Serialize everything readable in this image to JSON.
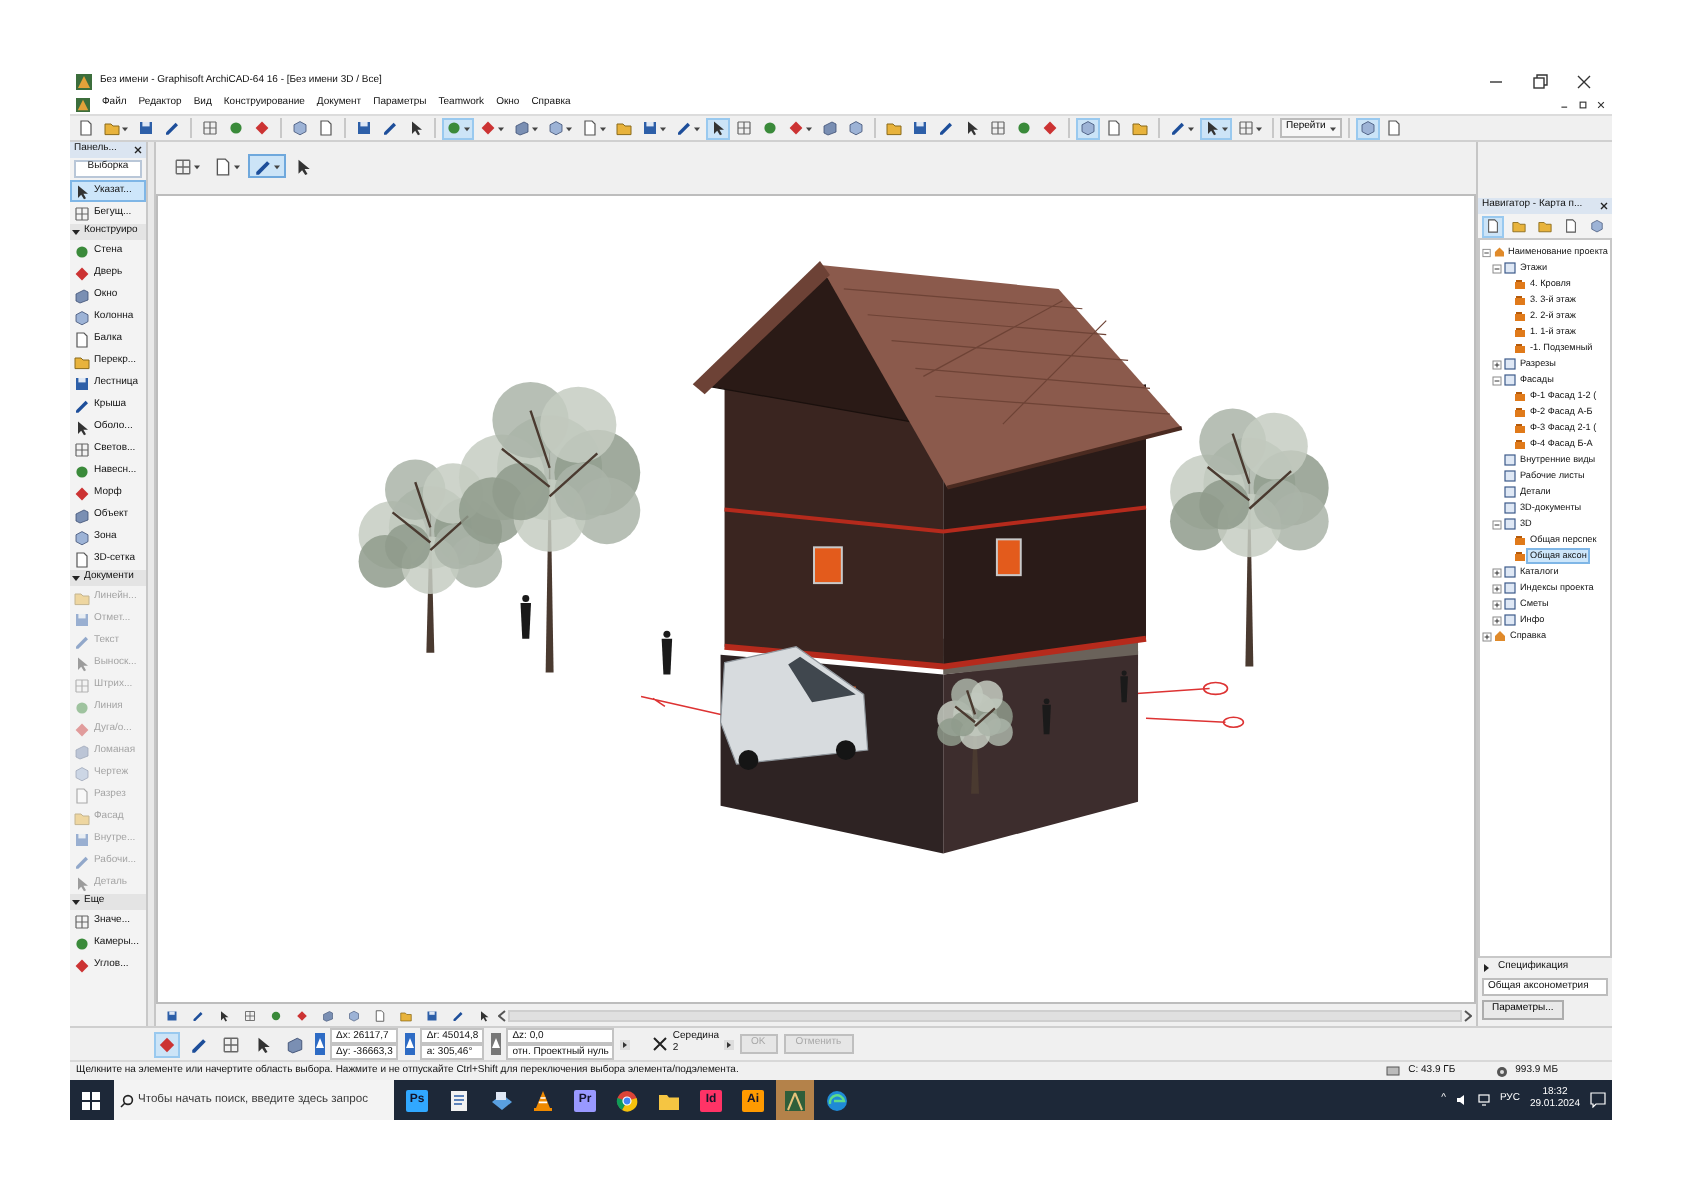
{
  "window": {
    "title": "Без имени - Graphisoft ArchiCAD-64 16 - [Без имени 3D / Все]"
  },
  "menu": [
    "Файл",
    "Редактор",
    "Вид",
    "Конструирование",
    "Документ",
    "Параметры",
    "Teamwork",
    "Окно",
    "Справка"
  ],
  "toolbar": [
    {
      "kind": "button",
      "selected": false
    },
    {
      "kind": "split",
      "selected": false
    },
    {
      "kind": "button",
      "selected": false
    },
    {
      "kind": "button",
      "selected": false
    },
    {
      "kind": "divider"
    },
    {
      "kind": "button",
      "selected": false
    },
    {
      "kind": "button",
      "selected": false
    },
    {
      "kind": "button",
      "selected": false
    },
    {
      "kind": "divider"
    },
    {
      "kind": "button",
      "selected": false
    },
    {
      "kind": "button",
      "selected": false
    },
    {
      "kind": "divider"
    },
    {
      "kind": "button",
      "selected": false
    },
    {
      "kind": "button",
      "selected": false
    },
    {
      "kind": "button",
      "selected": false
    },
    {
      "kind": "divider"
    },
    {
      "kind": "split",
      "selected": true
    },
    {
      "kind": "split",
      "selected": false
    },
    {
      "kind": "split",
      "selected": false
    },
    {
      "kind": "split",
      "selected": false
    },
    {
      "kind": "split",
      "selected": false
    },
    {
      "kind": "button",
      "selected": false
    },
    {
      "kind": "split",
      "selected": false
    },
    {
      "kind": "split",
      "selected": false
    },
    {
      "kind": "button",
      "selected": true
    },
    {
      "kind": "button",
      "selected": false
    },
    {
      "kind": "button",
      "selected": false
    },
    {
      "kind": "split",
      "selected": false
    },
    {
      "kind": "button",
      "selected": false
    },
    {
      "kind": "button",
      "selected": false
    },
    {
      "kind": "divider"
    },
    {
      "kind": "button",
      "selected": false
    },
    {
      "kind": "button",
      "selected": false
    },
    {
      "kind": "button",
      "selected": false
    },
    {
      "kind": "button",
      "selected": false
    },
    {
      "kind": "button",
      "selected": false
    },
    {
      "kind": "button",
      "selected": false
    },
    {
      "kind": "button",
      "selected": false
    },
    {
      "kind": "divider"
    },
    {
      "kind": "button",
      "selected": true
    },
    {
      "kind": "button",
      "selected": false
    },
    {
      "kind": "button",
      "selected": false
    },
    {
      "kind": "divider"
    },
    {
      "kind": "split",
      "selected": false
    },
    {
      "kind": "split",
      "selected": true
    },
    {
      "kind": "split",
      "selected": false
    },
    {
      "kind": "divider"
    },
    {
      "kind": "menu",
      "label": "Перейти"
    },
    {
      "kind": "divider"
    },
    {
      "kind": "button",
      "selected": true
    },
    {
      "kind": "button",
      "selected": false
    }
  ],
  "palette": {
    "title": "Панель...",
    "tab": "Выборка",
    "top_items": [
      {
        "label": "Указат...",
        "selected": true,
        "disabled": false
      },
      {
        "label": "Бегущ...",
        "selected": false,
        "disabled": false
      }
    ],
    "sections": [
      {
        "title": "Конструиро",
        "expanded": true,
        "items": [
          {
            "label": "Стена",
            "selected": false,
            "disabled": false
          },
          {
            "label": "Дверь",
            "selected": false,
            "disabled": false
          },
          {
            "label": "Окно",
            "selected": false,
            "disabled": false
          },
          {
            "label": "Колонна",
            "selected": false,
            "disabled": false
          },
          {
            "label": "Балка",
            "selected": false,
            "disabled": false
          },
          {
            "label": "Перекр...",
            "selected": false,
            "disabled": false
          },
          {
            "label": "Лестница",
            "selected": false,
            "disabled": false
          },
          {
            "label": "Крыша",
            "selected": false,
            "disabled": false
          },
          {
            "label": "Оболо...",
            "selected": false,
            "disabled": false
          },
          {
            "label": "Светов...",
            "selected": false,
            "disabled": false
          },
          {
            "label": "Навесн...",
            "selected": false,
            "disabled": false
          },
          {
            "label": "Морф",
            "selected": false,
            "disabled": false
          },
          {
            "label": "Объект",
            "selected": false,
            "disabled": false
          },
          {
            "label": "Зона",
            "selected": false,
            "disabled": false
          },
          {
            "label": "3D-сетка",
            "selected": false,
            "disabled": false
          }
        ]
      },
      {
        "title": "Документи",
        "expanded": true,
        "items": [
          {
            "label": "Линейн...",
            "selected": false,
            "disabled": true
          },
          {
            "label": "Отмет...",
            "selected": false,
            "disabled": true
          },
          {
            "label": "Текст",
            "selected": false,
            "disabled": true
          },
          {
            "label": "Выноск...",
            "selected": false,
            "disabled": true
          },
          {
            "label": "Штрих...",
            "selected": false,
            "disabled": true
          },
          {
            "label": "Линия",
            "selected": false,
            "disabled": true
          },
          {
            "label": "Дуга/о...",
            "selected": false,
            "disabled": true
          },
          {
            "label": "Ломаная",
            "selected": false,
            "disabled": true
          },
          {
            "label": "Чертеж",
            "selected": false,
            "disabled": true
          },
          {
            "label": "Разрез",
            "selected": false,
            "disabled": true
          },
          {
            "label": "Фасад",
            "selected": false,
            "disabled": true
          },
          {
            "label": "Внутре...",
            "selected": false,
            "disabled": true
          },
          {
            "label": "Рабочи...",
            "selected": false,
            "disabled": true
          },
          {
            "label": "Деталь",
            "selected": false,
            "disabled": true
          }
        ]
      },
      {
        "title": "Еще",
        "expanded": true,
        "items": [
          {
            "label": "Значе...",
            "selected": false,
            "disabled": false
          },
          {
            "label": "Камеры...",
            "selected": false,
            "disabled": false
          },
          {
            "label": "Углов...",
            "selected": false,
            "disabled": false
          }
        ]
      }
    ]
  },
  "view_toolbar": [
    {
      "selected": false
    },
    {
      "selected": false
    },
    {
      "selected": true
    },
    {
      "selected": false
    }
  ],
  "navigator": {
    "title": "Навигатор - Карта п...",
    "tools": [
      {
        "selected": true
      },
      {
        "selected": false
      },
      {
        "selected": false
      },
      {
        "selected": false
      },
      {
        "selected": false
      }
    ],
    "tree": [
      {
        "label": "Наименование проекта",
        "expanded": true,
        "selected": false,
        "children": [
          {
            "label": "Этажи",
            "expanded": true,
            "selected": false,
            "children": [
              {
                "label": "4. Кровля",
                "selected": false
              },
              {
                "label": "3. 3-й этаж",
                "selected": false
              },
              {
                "label": "2. 2-й этаж",
                "selected": false
              },
              {
                "label": "1. 1-й этаж",
                "selected": false
              },
              {
                "label": "-1. Подземный",
                "selected": false
              }
            ]
          },
          {
            "label": "Разрезы",
            "expanded": false,
            "selected": false
          },
          {
            "label": "Фасады",
            "expanded": true,
            "selected": false,
            "children": [
              {
                "label": "Ф-1 Фасад 1-2 (",
                "selected": false
              },
              {
                "label": "Ф-2 Фасад А-Б",
                "selected": false
              },
              {
                "label": "Ф-3 Фасад 2-1 (",
                "selected": false
              },
              {
                "label": "Ф-4 Фасад Б-А",
                "selected": false
              }
            ]
          },
          {
            "label": "Внутренние виды",
            "selected": false
          },
          {
            "label": "Рабочие листы",
            "selected": false
          },
          {
            "label": "Детали",
            "selected": false
          },
          {
            "label": "3D-документы",
            "selected": false
          },
          {
            "label": "3D",
            "expanded": true,
            "selected": false,
            "children": [
              {
                "label": "Общая перспек",
                "selected": false
              },
              {
                "label": "Общая аксон",
                "selected": true
              }
            ]
          },
          {
            "label": "Каталоги",
            "expanded": false,
            "selected": false
          },
          {
            "label": "Индексы проекта",
            "expanded": false,
            "selected": false
          },
          {
            "label": "Сметы",
            "expanded": false,
            "selected": false
          },
          {
            "label": "Инфо",
            "expanded": false,
            "selected": false
          }
        ]
      },
      {
        "label": "Справка",
        "expanded": false,
        "selected": false
      }
    ],
    "spec_label": "Спецификация",
    "view_name": "Общая аксонометрия",
    "button": "Параметры..."
  },
  "info_box": {
    "tools": [
      {
        "selected": true
      },
      {
        "selected": false
      },
      {
        "selected": false
      },
      {
        "selected": false
      },
      {
        "selected": false
      }
    ],
    "xy": [
      "Δx: 26117,7",
      "Δy: -36663,3"
    ],
    "polar": [
      "Δr: 45014,8",
      "a: 305,46°"
    ],
    "z": [
      "Δz: 0,0",
      "отн. Проектный нуль"
    ],
    "snap": [
      "Середина",
      "2"
    ],
    "buttons": [
      {
        "label": "OK",
        "disabled": true
      },
      {
        "label": "Отменить",
        "disabled": true
      }
    ]
  },
  "status_bar": {
    "message": "Щелкните на элементе или начертите область выбора. Нажмите и не отпускайте Ctrl+Shift для переключения выбора элемента/подэлемента.",
    "disk": "C: 43.9 ГБ",
    "memory": "993.9 МБ"
  },
  "taskbar": {
    "search": {
      "placeholder": "Чтобы начать поиск, введите здесь запрос"
    },
    "apps": [
      {
        "kind": "letter",
        "label": "Ps",
        "color": "#31a8ff",
        "selected": false
      },
      {
        "kind": "document",
        "selected": false
      },
      {
        "kind": "disk",
        "selected": false
      },
      {
        "kind": "cone",
        "selected": false
      },
      {
        "kind": "letter",
        "label": "Pr",
        "color": "#9999ff",
        "selected": false
      },
      {
        "kind": "browser",
        "selected": false
      },
      {
        "kind": "folder",
        "selected": false
      },
      {
        "kind": "letter",
        "label": "Id",
        "color": "#ff3366",
        "selected": false
      },
      {
        "kind": "letter",
        "label": "Ai",
        "color": "#ff9a00",
        "selected": false
      },
      {
        "kind": "archicad",
        "selected": true
      },
      {
        "kind": "edge",
        "selected": false
      }
    ],
    "tray": {
      "arrow": "^",
      "language": "РУС",
      "time": "18:32",
      "date": "29.01.2024"
    }
  }
}
